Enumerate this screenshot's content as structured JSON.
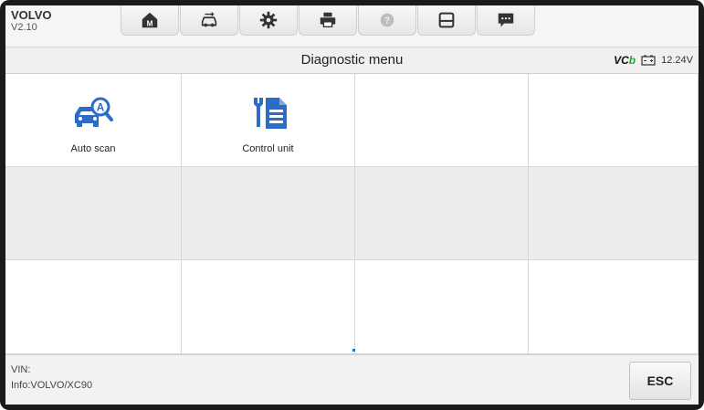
{
  "header": {
    "brand": "VOLVO",
    "version": "V2.10"
  },
  "toolbar": {
    "buttons": [
      {
        "icon": "home-icon"
      },
      {
        "icon": "vehicle-swap-icon"
      },
      {
        "icon": "settings-icon"
      },
      {
        "icon": "print-icon"
      },
      {
        "icon": "help-icon"
      },
      {
        "icon": "save-icon"
      },
      {
        "icon": "message-icon"
      }
    ]
  },
  "titlebar": {
    "title": "Diagnostic menu",
    "vci_logo": "VC",
    "vci_logo_accent": "b",
    "voltage": "12.24V"
  },
  "menu": {
    "items": [
      {
        "label": "Auto scan",
        "icon": "car-auto-scan-icon"
      },
      {
        "label": "Control unit",
        "icon": "wrench-document-icon"
      }
    ]
  },
  "footer": {
    "vin": "VIN:",
    "info": "Info:VOLVO/XC90",
    "esc_label": "ESC"
  },
  "colors": {
    "accent": "#2b6cc4",
    "vci_green": "#2e9d3a"
  }
}
